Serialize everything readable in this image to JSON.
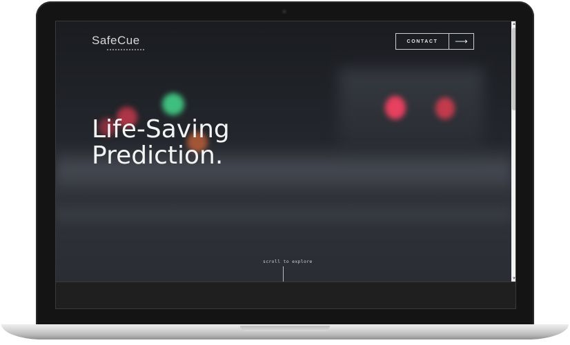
{
  "brand": {
    "name": "SafeCue"
  },
  "nav": {
    "contact_label": "CONTACT",
    "contact_arrow": "⟶"
  },
  "hero": {
    "headline_line1": "Life-Saving",
    "headline_line2": "Prediction."
  },
  "scroll_hint": {
    "label": "scroll to explore"
  },
  "scrollbar": {
    "up": "▲",
    "down": "▼"
  },
  "colors": {
    "traffic_green": "#3fbf7f",
    "traffic_red": "#e8405f",
    "traffic_orange": "#d96a3a",
    "text": "#f4f4f4"
  }
}
